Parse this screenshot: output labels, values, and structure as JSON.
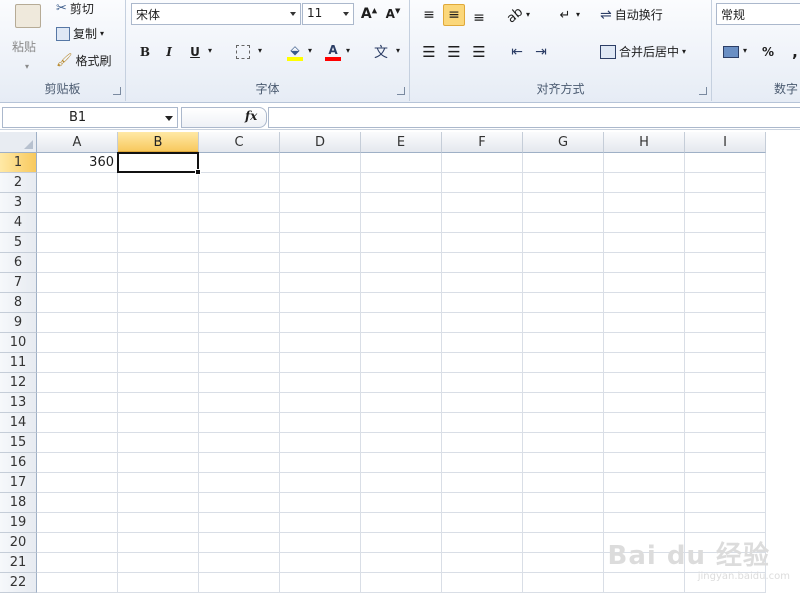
{
  "ribbon": {
    "clipboard": {
      "group_label": "剪贴板",
      "paste": "粘贴",
      "cut": "剪切",
      "copy": "复制",
      "format_painter": "格式刷"
    },
    "font": {
      "group_label": "字体",
      "font_name": "宋体",
      "font_size": "11",
      "bold": "B",
      "italic": "I",
      "underline": "U",
      "font_color_glyph": "A",
      "phonetic_glyph": "文"
    },
    "alignment": {
      "group_label": "对齐方式",
      "wrap_text": "自动换行",
      "merge_center": "合并后居中"
    },
    "number": {
      "group_label": "数字",
      "format": "常规",
      "percent": "%",
      "comma": ","
    }
  },
  "formula_bar": {
    "name_box": "B1",
    "fx": "fx",
    "value": ""
  },
  "grid": {
    "columns": [
      "A",
      "B",
      "C",
      "D",
      "E",
      "F",
      "G",
      "H",
      "I"
    ],
    "rows": [
      "1",
      "2",
      "3",
      "4",
      "5",
      "6",
      "7",
      "8",
      "9",
      "10",
      "11",
      "12",
      "13",
      "14",
      "15",
      "16",
      "17",
      "18",
      "19",
      "20",
      "21",
      "22"
    ],
    "selected_column": "B",
    "selected_row": "1",
    "cells": {
      "A1": "360"
    }
  },
  "watermark": {
    "brand": "Bai du 经验",
    "url": "jingyan.baidu.com"
  },
  "colors": {
    "accent": "#f8c95e",
    "ribbon_bg": "#e6ecf5",
    "grid_line": "#d9dee6"
  }
}
